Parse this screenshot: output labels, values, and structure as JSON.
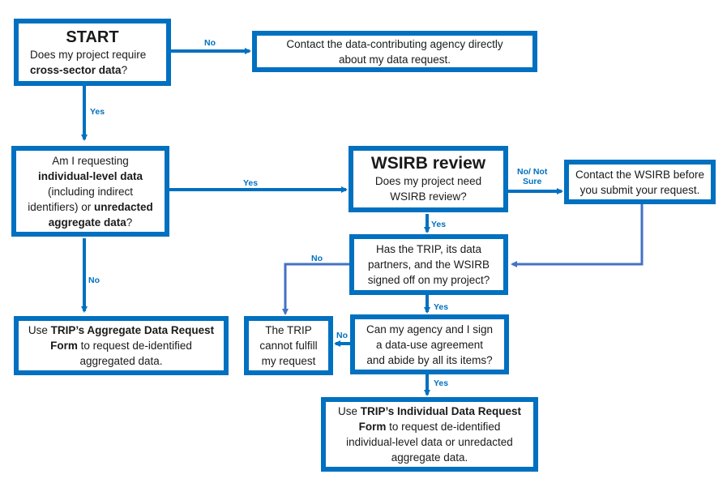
{
  "nodes": {
    "start": {
      "title": "START",
      "line1": "Does my project require",
      "bold": "cross-sector data",
      "tail": "?"
    },
    "contact_agency": {
      "line1": "Contact the data-contributing agency directly",
      "line2": "about my data request."
    },
    "individual_q": {
      "line1": "Am I requesting",
      "bold1": "individual-level data",
      "line2": "(including indirect",
      "line3a": "identifiers) or ",
      "bold2": "unredacted",
      "bold3": "aggregate data",
      "tail": "?"
    },
    "wsirb": {
      "title": "WSIRB review",
      "line1": "Does my project need",
      "line2": "WSIRB review?"
    },
    "contact_wsirb": {
      "line1": "Contact the WSIRB before",
      "line2": "you submit your request."
    },
    "signed_off": {
      "line1": "Has the TRIP, its data",
      "line2": "partners, and the WSIRB",
      "line3": "signed off on my project?"
    },
    "aggregate_form": {
      "pre": "Use ",
      "bold1": "TRIP’s  Aggregate Data Request",
      "bold2": "Form",
      "line2": " to request de-identified",
      "line3": "aggregated data."
    },
    "cannot_fulfill": {
      "line1": "The TRIP",
      "line2": "cannot fulfill",
      "line3": "my request"
    },
    "dua": {
      "line1": "Can my agency and I sign",
      "line2": "a data-use agreement",
      "line3": "and abide by all its items?"
    },
    "individual_form": {
      "pre": "Use ",
      "bold1": "TRIP’s  Individual Data Request",
      "bold2": "Form",
      "line2": " to request de-identified",
      "line3": "individual-level data or unredacted",
      "line4": "aggregate data."
    }
  },
  "edges": {
    "start_no": "No",
    "start_yes": "Yes",
    "individual_yes": "Yes",
    "individual_no": "No",
    "wsirb_no": "No/ Not",
    "wsirb_no2": "Sure",
    "wsirb_yes": "Yes",
    "signed_no": "No",
    "signed_yes": "Yes",
    "dua_no": "No",
    "dua_yes": "Yes"
  },
  "colors": {
    "primary": "#0070C0",
    "secondary": "#4472C4"
  }
}
